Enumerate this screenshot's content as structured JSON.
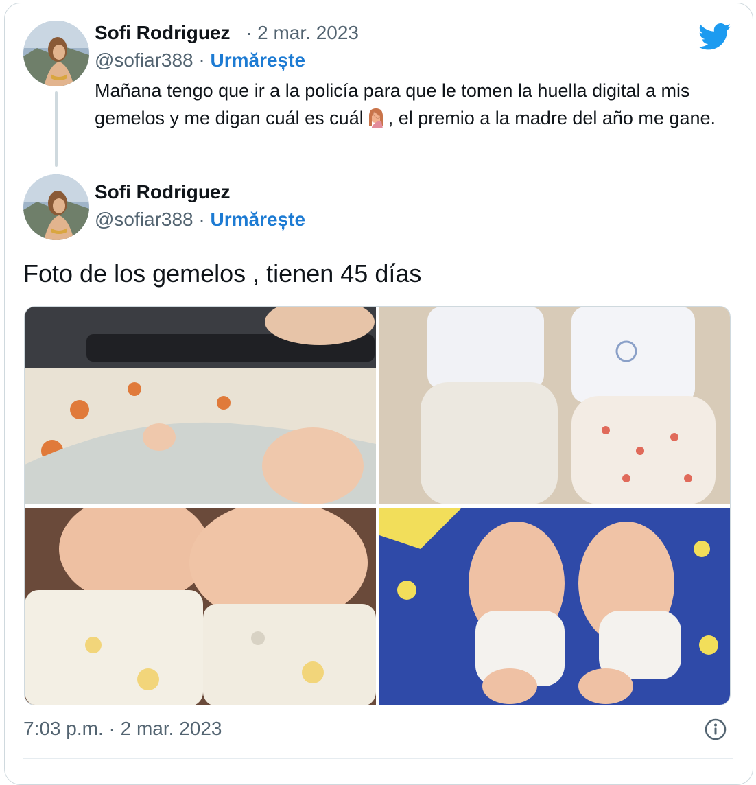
{
  "reply_tweet": {
    "author_name": "Sofi Rodriguez",
    "date": "· 2 mar. 2023",
    "handle": "@sofiar388",
    "separator": "·",
    "follow_label": "Urmărește",
    "text_before_emoji": "Mañana tengo que ir a la policía para que le tomen la huella digital a mis gemelos y me digan cuál es cuál",
    "emoji_icon": "face-palm-emoji",
    "text_after_emoji": ", el premio a la madre del año me gane."
  },
  "main_tweet": {
    "author_name": "Sofi Rodriguez",
    "handle": "@sofiar388",
    "separator": "·",
    "follow_label": "Urmărește",
    "text": "Foto de los gemelos , tienen 45 días",
    "photos": [
      {
        "name": "photo-1",
        "description_icon": "baby-photo"
      },
      {
        "name": "photo-2",
        "description_icon": "baby-photo"
      },
      {
        "name": "photo-3",
        "description_icon": "baby-photo"
      },
      {
        "name": "photo-4",
        "description_icon": "baby-photo"
      }
    ],
    "timestamp": "7:03 p.m. · 2 mar. 2023"
  },
  "icons": {
    "brand": "twitter-bird-icon",
    "info": "info-icon"
  },
  "colors": {
    "follow": "#1d7bd3",
    "brand": "#1d9bf0",
    "muted": "#536471",
    "border": "#cfd9de"
  }
}
